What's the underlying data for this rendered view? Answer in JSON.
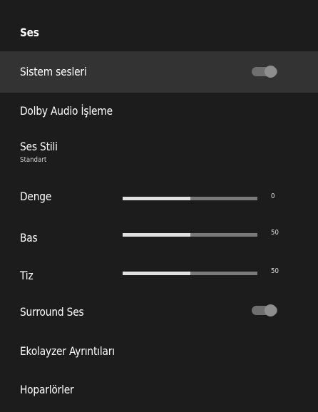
{
  "header": {
    "title": "Ses"
  },
  "items": {
    "system_sounds": {
      "label": "Sistem sesleri",
      "enabled": true
    },
    "dolby": {
      "label": "Dolby Audio İşleme"
    },
    "sound_style": {
      "label": "Ses Stili",
      "value": "Standart"
    },
    "balance": {
      "label": "Denge",
      "value": "0",
      "fill_fraction": 0.5
    },
    "bass": {
      "label": "Bas",
      "value": "50",
      "fill_fraction": 0.5
    },
    "treble": {
      "label": "Tiz",
      "value": "50",
      "fill_fraction": 0.5
    },
    "surround": {
      "label": "Surround Ses",
      "enabled": true
    },
    "equalizer": {
      "label": "Ekolayzer Ayrıntıları"
    },
    "speakers": {
      "label": "Hoparlörler"
    }
  },
  "colors": {
    "background": "#1c1c1c",
    "highlight": "#333333",
    "text": "#ffffff",
    "slider_fill": "#e0e0e0",
    "slider_track": "#7a7a7a",
    "toggle_track": "#6f6f6f",
    "toggle_knob": "#8e8e8e"
  }
}
